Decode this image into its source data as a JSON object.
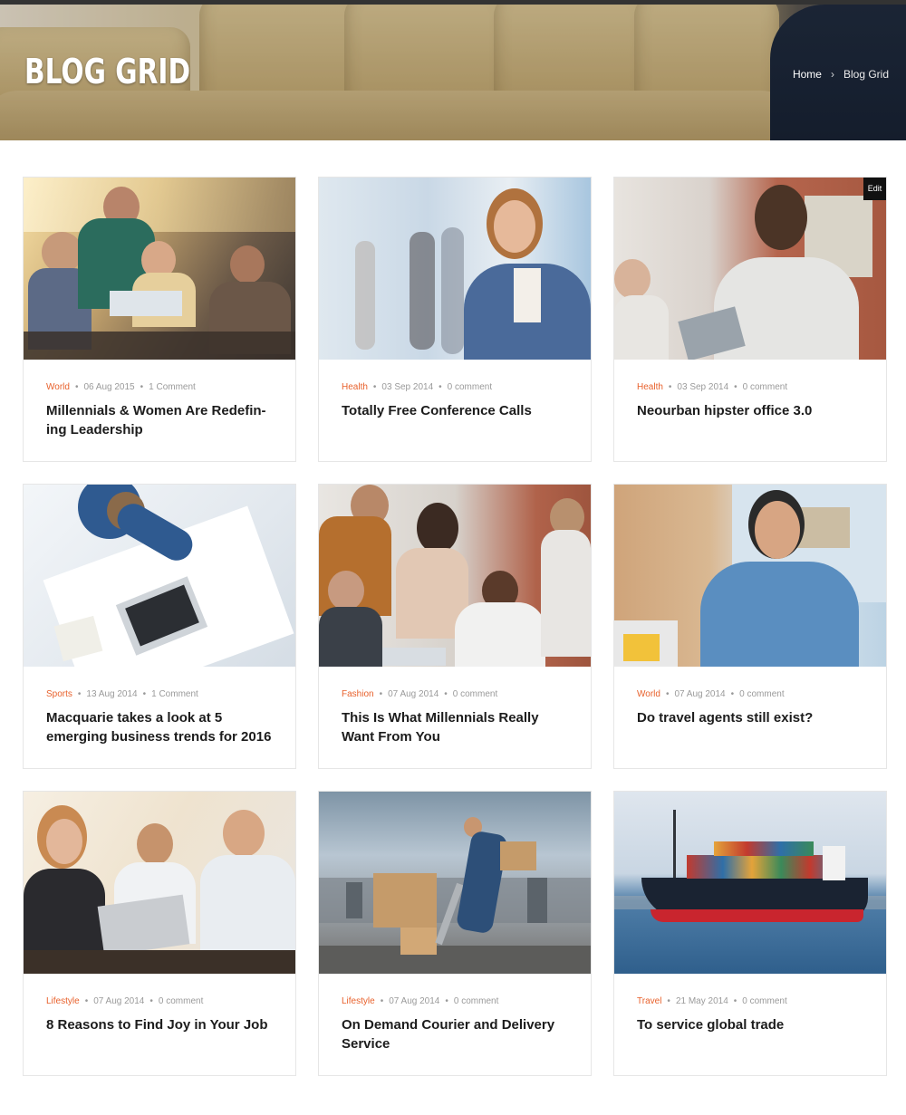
{
  "hero": {
    "title": "BLOG GRID",
    "breadcrumb": {
      "home": "Home",
      "separator": ">",
      "current": "Blog Grid"
    }
  },
  "edit_label": "Edit",
  "accent_color": "#e8612c",
  "posts": [
    {
      "category": "World",
      "date": "06 Aug 2015",
      "comments": "1 Comment",
      "title": "Millennials & Women Are Redefin-ing Leadership"
    },
    {
      "category": "Health",
      "date": "03 Sep 2014",
      "comments": "0 comment",
      "title": "Totally Free Conference Calls"
    },
    {
      "category": "Health",
      "date": "03 Sep 2014",
      "comments": "0 comment",
      "title": "Neourban hipster office 3.0"
    },
    {
      "category": "Sports",
      "date": "13 Aug 2014",
      "comments": "1 Comment",
      "title": "Macquarie takes a look at 5 emerging business trends for 2016"
    },
    {
      "category": "Fashion",
      "date": "07 Aug 2014",
      "comments": "0 comment",
      "title": "This Is What Millennials Really Want From You"
    },
    {
      "category": "World",
      "date": "07 Aug 2014",
      "comments": "0 comment",
      "title": "Do travel agents still exist?"
    },
    {
      "category": "Lifestyle",
      "date": "07 Aug 2014",
      "comments": "0 comment",
      "title": "8 Reasons to Find Joy in Your Job"
    },
    {
      "category": "Lifestyle",
      "date": "07 Aug 2014",
      "comments": "0 comment",
      "title": "On Demand Courier and Delivery Service"
    },
    {
      "category": "Travel",
      "date": "21 May 2014",
      "comments": "0 comment",
      "title": "To service global trade"
    }
  ]
}
